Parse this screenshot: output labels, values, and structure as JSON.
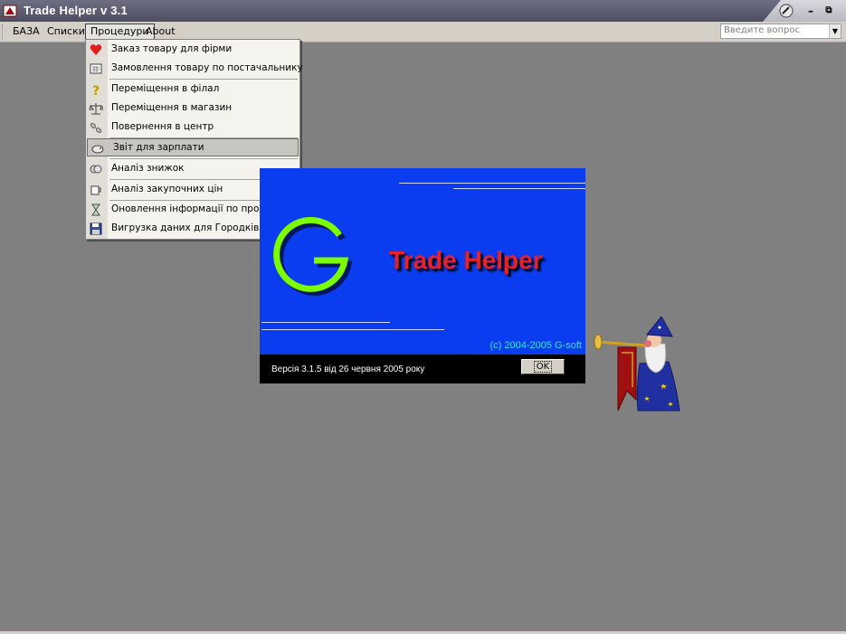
{
  "window": {
    "title": "Trade Helper v 3.1",
    "controls": [
      "minimize-icon",
      "restore-icon"
    ]
  },
  "menubar": {
    "items": [
      {
        "label": "БАЗА"
      },
      {
        "label": "Списки"
      },
      {
        "label": "Процедури",
        "open": true
      },
      {
        "label": "About"
      }
    ],
    "ask_placeholder": "Введите вопрос"
  },
  "dropdown": {
    "items": [
      {
        "label": "Заказ товару для фірми",
        "icon": "heart-icon"
      },
      {
        "label": "Замовлення товару по постачальнику",
        "icon": "calculator-icon"
      },
      {
        "label": "Переміщення в філал",
        "icon": "question-icon"
      },
      {
        "label": "Переміщення в магазин",
        "icon": "scales-icon"
      },
      {
        "label": "Повернення в центр",
        "icon": "pills-icon"
      },
      {
        "label": "Звіт для зарплати",
        "icon": "piggy-bank-icon",
        "highlighted": true
      },
      {
        "label": "Аналіз знижок",
        "icon": "coins-icon"
      },
      {
        "label": "Аналіз закупочних цін",
        "icon": "mug-icon"
      },
      {
        "label": "Оновлення інформації по продажі",
        "icon": "hourglass-icon"
      },
      {
        "label": "Вигрузка даних для Городківки",
        "icon": "floppy-icon"
      }
    ]
  },
  "splash": {
    "logo_letter": "G",
    "brand": "Trade Helper",
    "copyright": "(c) 2004-2005 G-soft",
    "version": "Версія 3.1.5 від 26 червня 2005 року",
    "ok_label": "OK",
    "colors": {
      "background": "#0a3cf0",
      "brand": "#e8202c",
      "logo": "#7cfc00",
      "copyright": "#40e0e8"
    }
  },
  "assistant": {
    "icon": "wizard-assistant-icon"
  }
}
